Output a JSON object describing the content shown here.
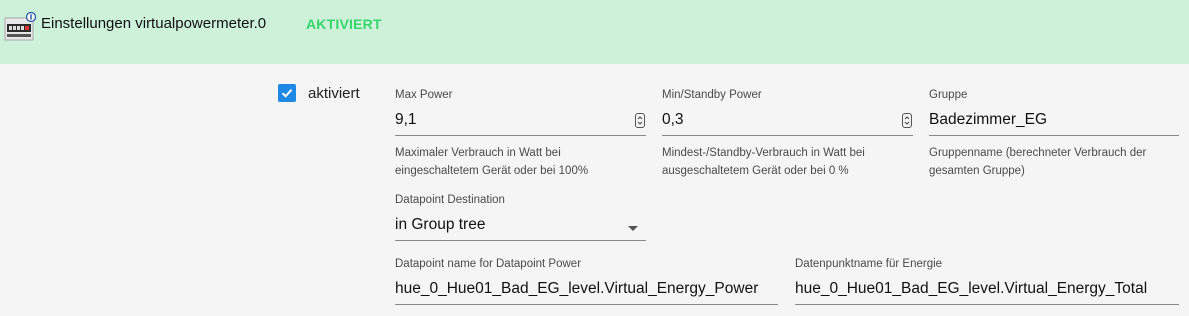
{
  "header": {
    "title": "Einstellungen virtualpowermeter.0",
    "status": "AKTIVIERT",
    "logo_icon": "virtualpowermeter-logo-icon",
    "status_color": "#35d66a",
    "background_color": "#cdf1d9"
  },
  "enabled": {
    "label": "aktiviert",
    "checked": true
  },
  "fields": {
    "max_power": {
      "label": "Max Power",
      "value": "9,1",
      "help": "Maximaler Verbrauch in Watt bei eingeschaltetem Gerät oder bei 100%"
    },
    "min_power": {
      "label": "Min/Standby Power",
      "value": "0,3",
      "help": "Mindest-/Standby-Verbrauch in Watt bei ausgeschaltetem Gerät oder bei 0 %"
    },
    "group": {
      "label": "Gruppe",
      "value": "Badezimmer_EG",
      "help": "Gruppenname (berechneter Verbrauch der gesamten Gruppe)"
    },
    "destination": {
      "label": "Datapoint Destination",
      "value": "in Group tree"
    },
    "dp_power": {
      "label": "Datapoint name for Datapoint Power",
      "value": "hue_0_Hue01_Bad_EG_level.Virtual_Energy_Power"
    },
    "dp_energy": {
      "label": "Datenpunktname für Energie",
      "value": "hue_0_Hue01_Bad_EG_level.Virtual_Energy_Total"
    }
  }
}
